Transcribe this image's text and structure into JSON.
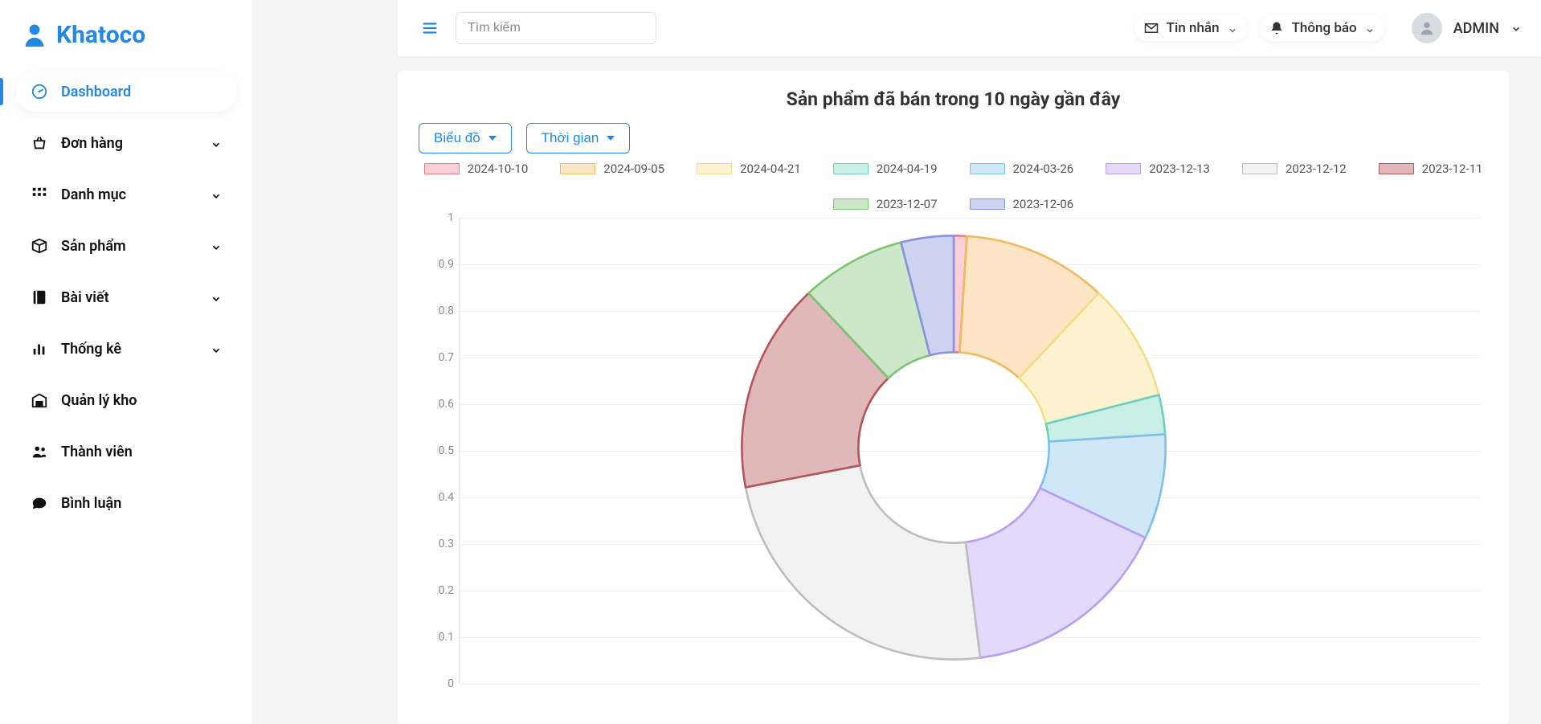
{
  "brand": {
    "name": "Khatoco"
  },
  "sidebar": {
    "items": [
      {
        "label": "Dashboard",
        "icon": "dashboard",
        "expandable": false,
        "active": true
      },
      {
        "label": "Đơn hàng",
        "icon": "basket",
        "expandable": true,
        "active": false
      },
      {
        "label": "Danh mục",
        "icon": "grid",
        "expandable": true,
        "active": false
      },
      {
        "label": "Sản phẩm",
        "icon": "box",
        "expandable": true,
        "active": false
      },
      {
        "label": "Bài viết",
        "icon": "book",
        "expandable": true,
        "active": false
      },
      {
        "label": "Thống kê",
        "icon": "bars",
        "expandable": true,
        "active": false
      },
      {
        "label": "Quản lý kho",
        "icon": "warehouse",
        "expandable": false,
        "active": false
      },
      {
        "label": "Thành viên",
        "icon": "users",
        "expandable": false,
        "active": false
      },
      {
        "label": "Bình luận",
        "icon": "comment",
        "expandable": false,
        "active": false
      }
    ]
  },
  "topbar": {
    "search_placeholder": "Tìm kiếm",
    "messages_label": "Tin nhắn",
    "notifications_label": "Thông báo",
    "user_name": "ADMIN"
  },
  "chart": {
    "title": "Sản phẩm đã bán trong 10 ngày gần đây",
    "chart_type_btn": "Biểu đồ",
    "time_range_btn": "Thời gian"
  },
  "chart_data": {
    "type": "pie",
    "title": "Sản phẩm đã bán trong 10 ngày gần đây",
    "ylim": [
      0,
      1
    ],
    "yticks": [
      0,
      0.1,
      0.2,
      0.3,
      0.4,
      0.5,
      0.6,
      0.7,
      0.8,
      0.9,
      1
    ],
    "series": [
      {
        "name": "2024-10-10",
        "value": 0.01,
        "fill": "#f9d0d6",
        "stroke": "#e77a8d"
      },
      {
        "name": "2024-09-05",
        "value": 0.11,
        "fill": "#fbe5c4",
        "stroke": "#f0b962"
      },
      {
        "name": "2024-04-21",
        "value": 0.09,
        "fill": "#fdf2d0",
        "stroke": "#f3dd86"
      },
      {
        "name": "2024-04-19",
        "value": 0.03,
        "fill": "#c9efe8",
        "stroke": "#6cd0bd"
      },
      {
        "name": "2024-03-26",
        "value": 0.08,
        "fill": "#cfe7f7",
        "stroke": "#7cc0eb"
      },
      {
        "name": "2023-12-13",
        "value": 0.16,
        "fill": "#e4d9fb",
        "stroke": "#b89df4"
      },
      {
        "name": "2023-12-12",
        "value": 0.24,
        "fill": "#f2f2f2",
        "stroke": "#bdbdbd"
      },
      {
        "name": "2023-12-11",
        "value": 0.16,
        "fill": "#e0b8b9",
        "stroke": "#b35659"
      },
      {
        "name": "2023-12-07",
        "value": 0.08,
        "fill": "#cde8c8",
        "stroke": "#7bc36e"
      },
      {
        "name": "2023-12-06",
        "value": 0.04,
        "fill": "#cfd3f2",
        "stroke": "#8792e0"
      }
    ]
  }
}
